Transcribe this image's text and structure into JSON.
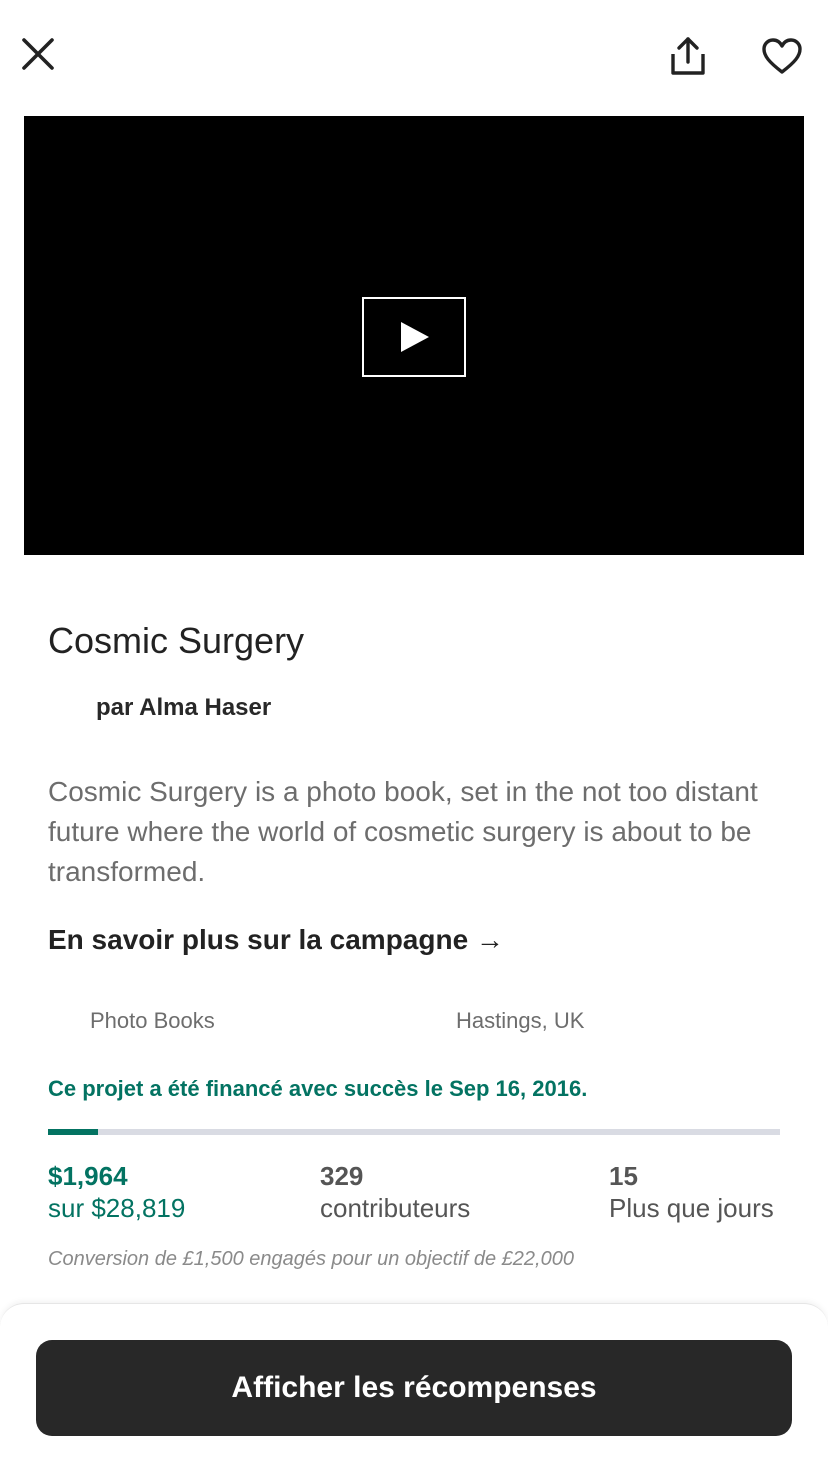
{
  "header": {
    "close_icon": "close-icon",
    "share_icon": "share-icon",
    "heart_icon": "heart-icon"
  },
  "video": {
    "play_icon": "play-icon"
  },
  "project": {
    "title": "Cosmic Surgery",
    "byline": "par Alma Haser",
    "blurb": "Cosmic Surgery is a photo book, set in the not too distant future where the world of cosmetic surgery is about to be transformed.",
    "learn_more": "En savoir plus sur la campagne →",
    "category": "Photo Books",
    "location": "Hastings, UK",
    "funded_message": "Ce projet a été financé avec succès le Sep 16, 2016."
  },
  "progress": {
    "fraction": 0.068
  },
  "stats": {
    "pledged": "$1,964",
    "goal": "sur $28,819",
    "backers": "329",
    "backers_label": "contributeurs",
    "days": "15",
    "days_label": "Plus que jours"
  },
  "conversion_note": "Conversion de £1,500 engagés pour un objectif de £22,000",
  "cta": {
    "label": "Afficher les récompenses"
  },
  "colors": {
    "accent": "#037362",
    "dark": "#282828",
    "muted": "#6d6d6d",
    "track": "#d9dbe3"
  }
}
